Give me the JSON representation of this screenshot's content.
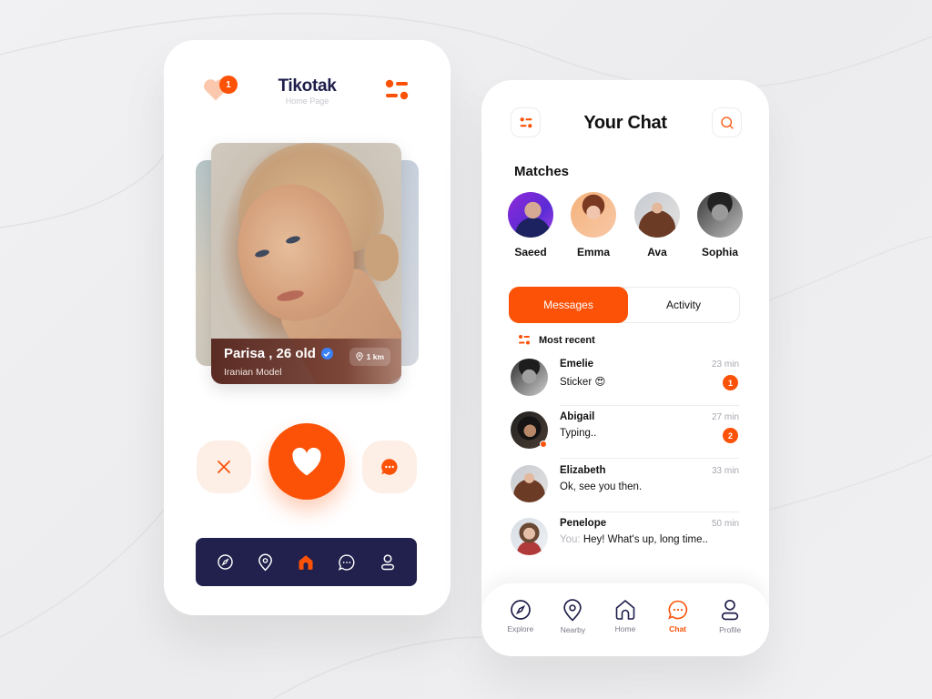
{
  "colors": {
    "accent": "#fb5208",
    "navy": "#22214d",
    "accent_soft": "#fdeee6"
  },
  "home": {
    "app_title": "Tikotak",
    "subtitle": "Home Page",
    "likes_badge": "1",
    "icons": {
      "likes": "heart-icon",
      "filter": "filter-icon"
    },
    "profile": {
      "name": "Parisa , 26 old",
      "verified": true,
      "role": "Iranian Model",
      "distance": "1 km"
    },
    "actions": [
      {
        "name": "reject",
        "icon": "close-icon"
      },
      {
        "name": "like",
        "icon": "heart-icon"
      },
      {
        "name": "message",
        "icon": "chat-bubble-icon"
      }
    ],
    "nav": [
      {
        "name": "explore",
        "icon": "compass-icon",
        "active": false
      },
      {
        "name": "nearby",
        "icon": "location-pin-icon",
        "active": false
      },
      {
        "name": "home",
        "icon": "home-icon",
        "active": true
      },
      {
        "name": "chat",
        "icon": "chat-bubble-icon",
        "active": false
      },
      {
        "name": "profile",
        "icon": "user-icon",
        "active": false
      }
    ]
  },
  "chat": {
    "title": "Your Chat",
    "matches_heading": "Matches",
    "matches": [
      {
        "name": "Saeed"
      },
      {
        "name": "Emma"
      },
      {
        "name": "Ava"
      },
      {
        "name": "Sophia"
      }
    ],
    "tabs": [
      {
        "label": "Messages",
        "active": true
      },
      {
        "label": "Activity",
        "active": false
      }
    ],
    "sort_label": "Most recent",
    "conversations": [
      {
        "name": "Emelie",
        "message": "Sticker 😍",
        "time": "23 min",
        "unread": "1",
        "online": false,
        "prefix": ""
      },
      {
        "name": "Abigail",
        "message": "Typing..",
        "time": "27 min",
        "unread": "2",
        "online": true,
        "prefix": ""
      },
      {
        "name": "Elizabeth",
        "message": "Ok, see you then.",
        "time": "33 min",
        "unread": "",
        "online": false,
        "prefix": ""
      },
      {
        "name": "Penelope",
        "message": "Hey! What's up, long time..",
        "time": "50 min",
        "unread": "",
        "online": false,
        "prefix": "You:"
      }
    ],
    "nav": [
      {
        "label": "Explore",
        "icon": "compass-icon",
        "active": false
      },
      {
        "label": "Nearby",
        "icon": "location-pin-icon",
        "active": false
      },
      {
        "label": "Home",
        "icon": "home-icon",
        "active": false
      },
      {
        "label": "Chat",
        "icon": "chat-bubble-icon",
        "active": true
      },
      {
        "label": "Profile",
        "icon": "user-icon",
        "active": false
      }
    ]
  }
}
